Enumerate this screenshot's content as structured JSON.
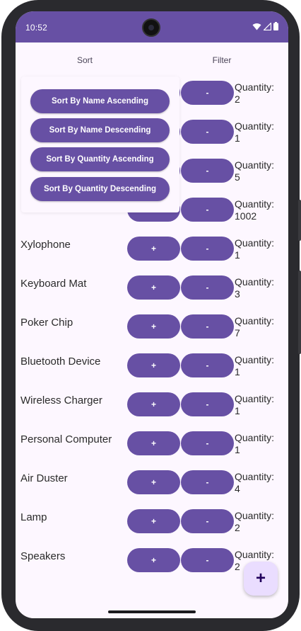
{
  "status_bar": {
    "time": "10:52",
    "bg_color": "#6750a4",
    "icons": [
      "wifi-icon",
      "signal-icon",
      "battery-icon"
    ]
  },
  "top_bar": {
    "sort_label": "Sort",
    "filter_label": "Filter"
  },
  "sort_menu": {
    "items": [
      {
        "label": "Sort By Name Ascending"
      },
      {
        "label": "Sort By Name Descending"
      },
      {
        "label": "Sort By Quantity Ascending"
      },
      {
        "label": "Sort By Quantity Descending"
      }
    ]
  },
  "items": [
    {
      "name": "",
      "plus": "+",
      "minus": "-",
      "qty_label": "Quantity:",
      "qty": "2"
    },
    {
      "name": "",
      "plus": "+",
      "minus": "-",
      "qty_label": "Quantity:",
      "qty": "1"
    },
    {
      "name": "",
      "plus": "+",
      "minus": "-",
      "qty_label": "Quantity:",
      "qty": "5"
    },
    {
      "name": "",
      "plus": "+",
      "minus": "-",
      "qty_label": "Quantity:",
      "qty": "1002"
    },
    {
      "name": "Xylophone",
      "plus": "+",
      "minus": "-",
      "qty_label": "Quantity:",
      "qty": "1"
    },
    {
      "name": "Keyboard Mat",
      "plus": "+",
      "minus": "-",
      "qty_label": "Quantity:",
      "qty": "3"
    },
    {
      "name": "Poker Chip",
      "plus": "+",
      "minus": "-",
      "qty_label": "Quantity:",
      "qty": "7"
    },
    {
      "name": "Bluetooth Device",
      "plus": "+",
      "minus": "-",
      "qty_label": "Quantity:",
      "qty": "1"
    },
    {
      "name": "Wireless Charger",
      "plus": "+",
      "minus": "-",
      "qty_label": "Quantity:",
      "qty": "1"
    },
    {
      "name": "Personal Computer",
      "plus": "+",
      "minus": "-",
      "qty_label": "Quantity:",
      "qty": "1"
    },
    {
      "name": "Air Duster",
      "plus": "+",
      "minus": "-",
      "qty_label": "Quantity:",
      "qty": "4"
    },
    {
      "name": "Lamp",
      "plus": "+",
      "minus": "-",
      "qty_label": "Quantity:",
      "qty": "2"
    },
    {
      "name": "Speakers",
      "plus": "+",
      "minus": "-",
      "qty_label": "Quantity:",
      "qty": "2"
    }
  ],
  "fab": {
    "label": "+"
  },
  "colors": {
    "primary": "#6750a4",
    "background": "#fdf7ff",
    "fab_bg": "#eaddff",
    "fab_fg": "#21005d"
  }
}
